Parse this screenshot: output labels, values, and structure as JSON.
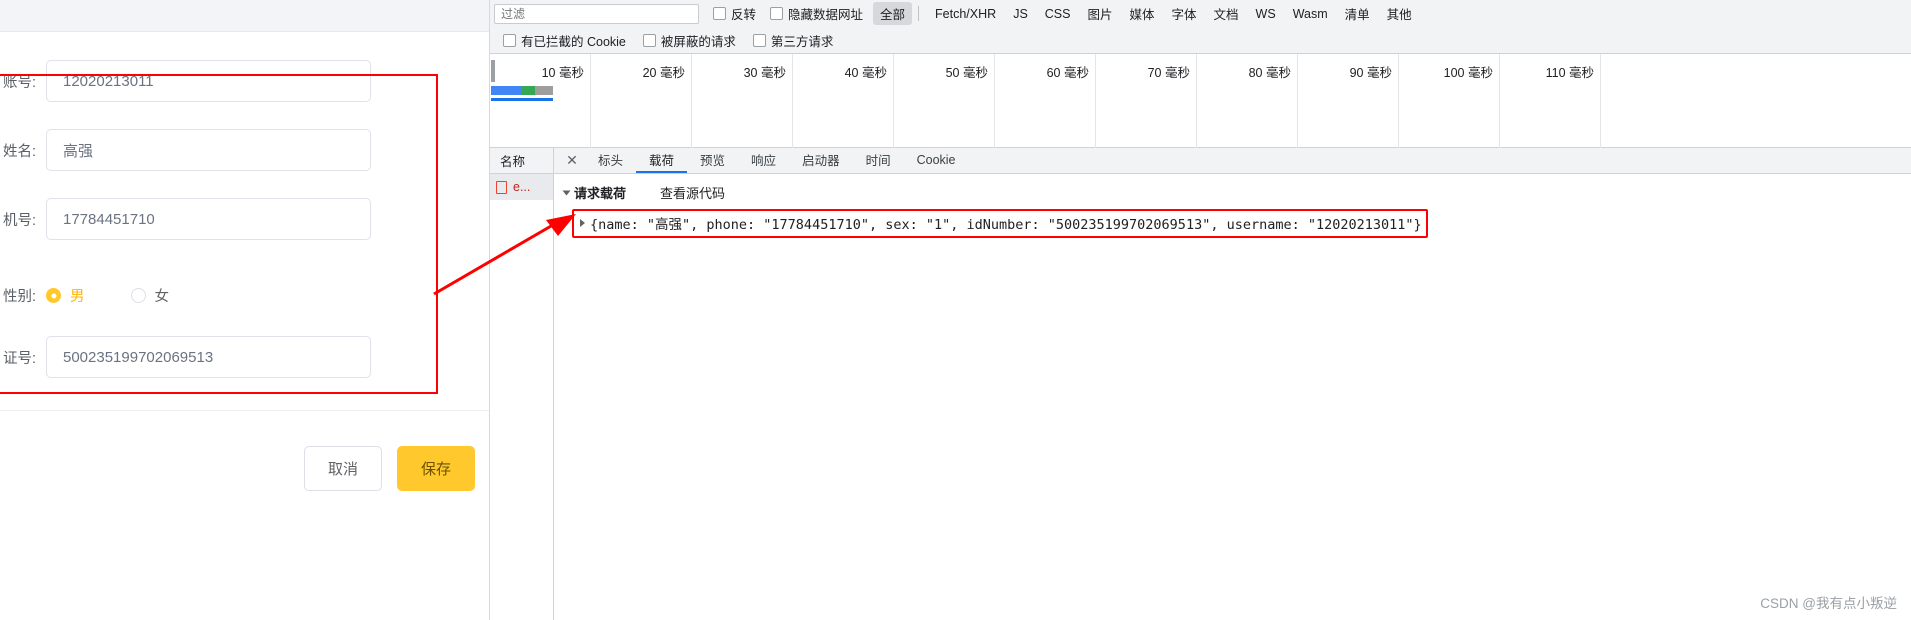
{
  "form": {
    "fields": [
      {
        "label": "账号:",
        "value": "12020213011"
      },
      {
        "label": "姓名:",
        "value": "高强"
      },
      {
        "label": "机号:",
        "value": "17784451710"
      }
    ],
    "gender": {
      "label": "性别:",
      "options": [
        {
          "label": "男",
          "selected": true
        },
        {
          "label": "女",
          "selected": false
        }
      ]
    },
    "id_field": {
      "label": "证号:",
      "value": "500235199702069513"
    },
    "buttons": {
      "cancel": "取消",
      "save": "保存"
    },
    "accent_color": "#FFC82C",
    "highlight_color": "#ff0000"
  },
  "devtools": {
    "filter": {
      "placeholder": "过滤",
      "invert_label": "反转",
      "hide_data_urls_label": "隐藏数据网址",
      "types": [
        "全部",
        "Fetch/XHR",
        "JS",
        "CSS",
        "图片",
        "媒体",
        "字体",
        "文档",
        "WS",
        "Wasm",
        "清单",
        "其他"
      ],
      "selected_type": "全部"
    },
    "filter_row2": [
      "有已拦截的 Cookie",
      "被屏蔽的请求",
      "第三方请求"
    ],
    "timeline": {
      "ticks": [
        "10 毫秒",
        "20 毫秒",
        "30 毫秒",
        "40 毫秒",
        "50 毫秒",
        "60 毫秒",
        "70 毫秒",
        "80 毫秒",
        "90 毫秒",
        "100 毫秒",
        "110 毫秒"
      ]
    },
    "request_list": {
      "header": "名称",
      "rows": [
        {
          "name": "e..."
        }
      ]
    },
    "detail": {
      "close_icon": "✕",
      "tabs": [
        {
          "label": "标头",
          "active": false
        },
        {
          "label": "载荷",
          "active": true
        },
        {
          "label": "预览",
          "active": false
        },
        {
          "label": "响应",
          "active": false
        },
        {
          "label": "启动器",
          "active": false
        },
        {
          "label": "时间",
          "active": false
        },
        {
          "label": "Cookie",
          "active": false
        }
      ],
      "payload_section_title": "请求载荷",
      "view_source_label": "查看源代码",
      "payload_json": "{name: \"高强\", phone: \"17784451710\", sex: \"1\", idNumber: \"500235199702069513\", username: \"12020213011\"}"
    }
  },
  "watermark": "CSDN @我有点小叛逆"
}
